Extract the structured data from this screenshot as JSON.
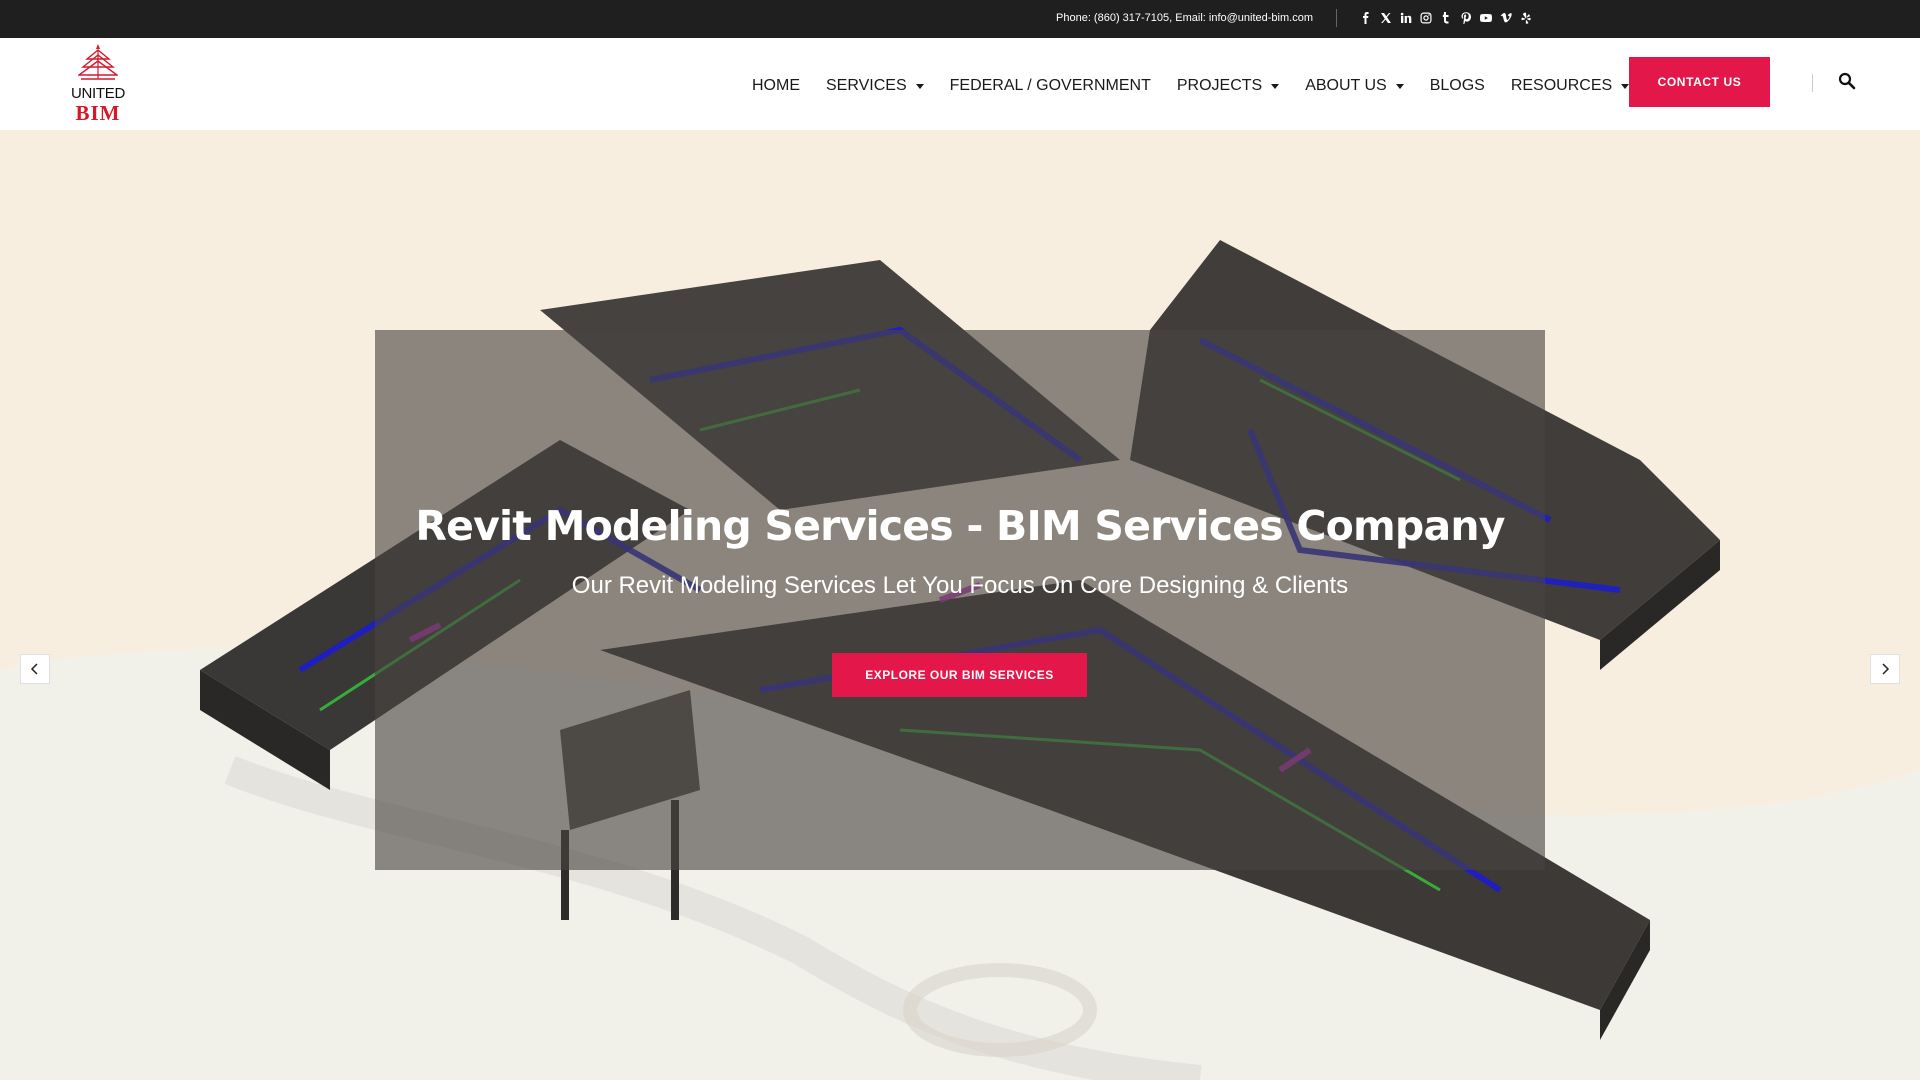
{
  "topbar": {
    "contact_text": "Phone: (860) 317-7105, Email: info@united-bim.com",
    "socials": [
      {
        "icon": "facebook-icon",
        "glyph": "f"
      },
      {
        "icon": "x-twitter-icon",
        "glyph": "𝕏"
      },
      {
        "icon": "linkedin-icon",
        "glyph": "in"
      },
      {
        "icon": "instagram-icon",
        "glyph": "◎"
      },
      {
        "icon": "tumblr-icon",
        "glyph": "t"
      },
      {
        "icon": "pinterest-icon",
        "glyph": "P"
      },
      {
        "icon": "youtube-icon",
        "glyph": "▶"
      },
      {
        "icon": "vimeo-icon",
        "glyph": "v"
      },
      {
        "icon": "yelp-icon",
        "glyph": "✱"
      }
    ]
  },
  "logo": {
    "top_text": "UNITED",
    "bottom_text": "BIM"
  },
  "nav": {
    "items": [
      {
        "label": "HOME",
        "has_dropdown": false
      },
      {
        "label": "SERVICES",
        "has_dropdown": true
      },
      {
        "label": "FEDERAL / GOVERNMENT",
        "has_dropdown": false
      },
      {
        "label": "PROJECTS",
        "has_dropdown": true
      },
      {
        "label": "ABOUT US",
        "has_dropdown": true
      },
      {
        "label": "BLOGS",
        "has_dropdown": false
      },
      {
        "label": "RESOURCES",
        "has_dropdown": true
      }
    ],
    "contact_button": "CONTACT US"
  },
  "hero": {
    "title": "Revit Modeling Services - BIM Services Company",
    "subtitle": "Our Revit Modeling Services Let You Focus On Core Designing & Clients",
    "button_label": "EXPLORE OUR BIM SERVICES"
  },
  "colors": {
    "accent": "#e3174a",
    "topbar_bg": "#1f1f1f",
    "hero_bg": "#f8eee0",
    "logo_red": "#d6182b"
  }
}
